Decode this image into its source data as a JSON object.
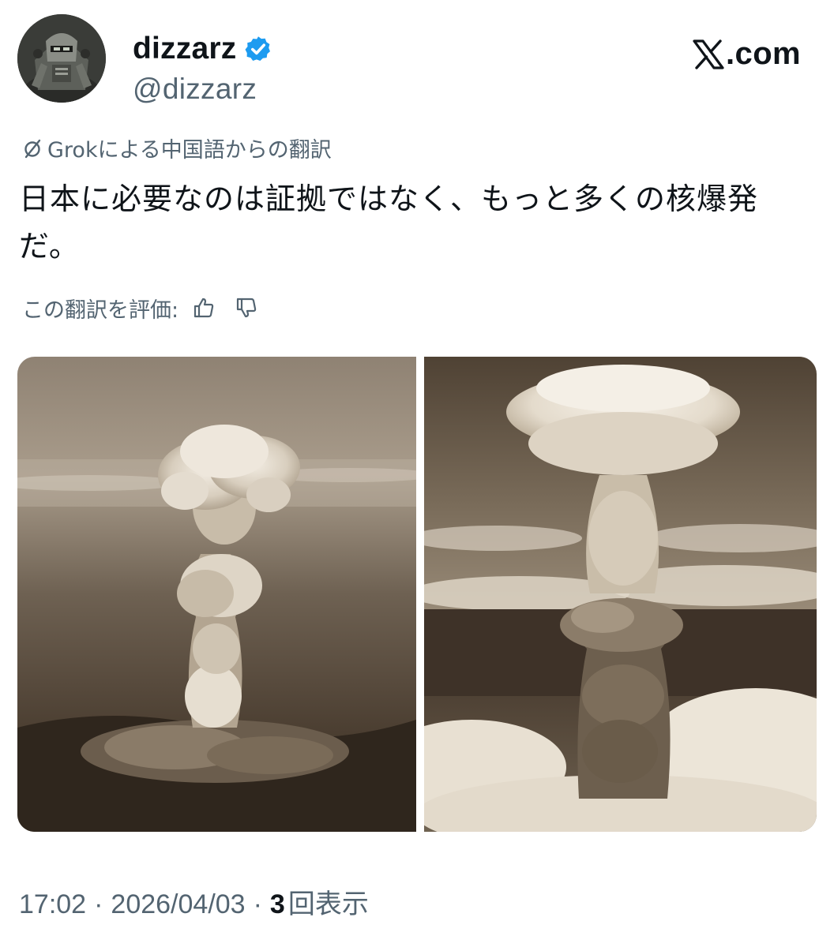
{
  "author": {
    "display_name": "dizzarz",
    "handle": "@dizzarz",
    "verified": true,
    "verified_color": "#1d9bf0"
  },
  "site": {
    "logo_glyph": "𝕏",
    "logo_text": ".com"
  },
  "translation": {
    "icon": "grok-slash-icon",
    "note": "Grokによる中国語からの翻訳"
  },
  "tweet": {
    "text": "日本に必要なのは証拠ではなく、もっと多くの核爆発だ。"
  },
  "rating": {
    "label": "この翻訳を評価:",
    "like_icon": "thumbs-up-icon",
    "dislike_icon": "thumbs-down-icon"
  },
  "media": [
    {
      "kind": "sepia-photo",
      "subject": "mushroom-cloud"
    },
    {
      "kind": "sepia-photo",
      "subject": "mushroom-cloud"
    }
  ],
  "meta": {
    "time": "17:02",
    "separator": "·",
    "date": "2026/04/03",
    "views_count": "3",
    "views_label": "回表示"
  },
  "colors": {
    "text_primary": "#0f1419",
    "text_secondary": "#536471",
    "sepia_dark": "#3b2f24",
    "sepia_light": "#e8e0d2"
  }
}
